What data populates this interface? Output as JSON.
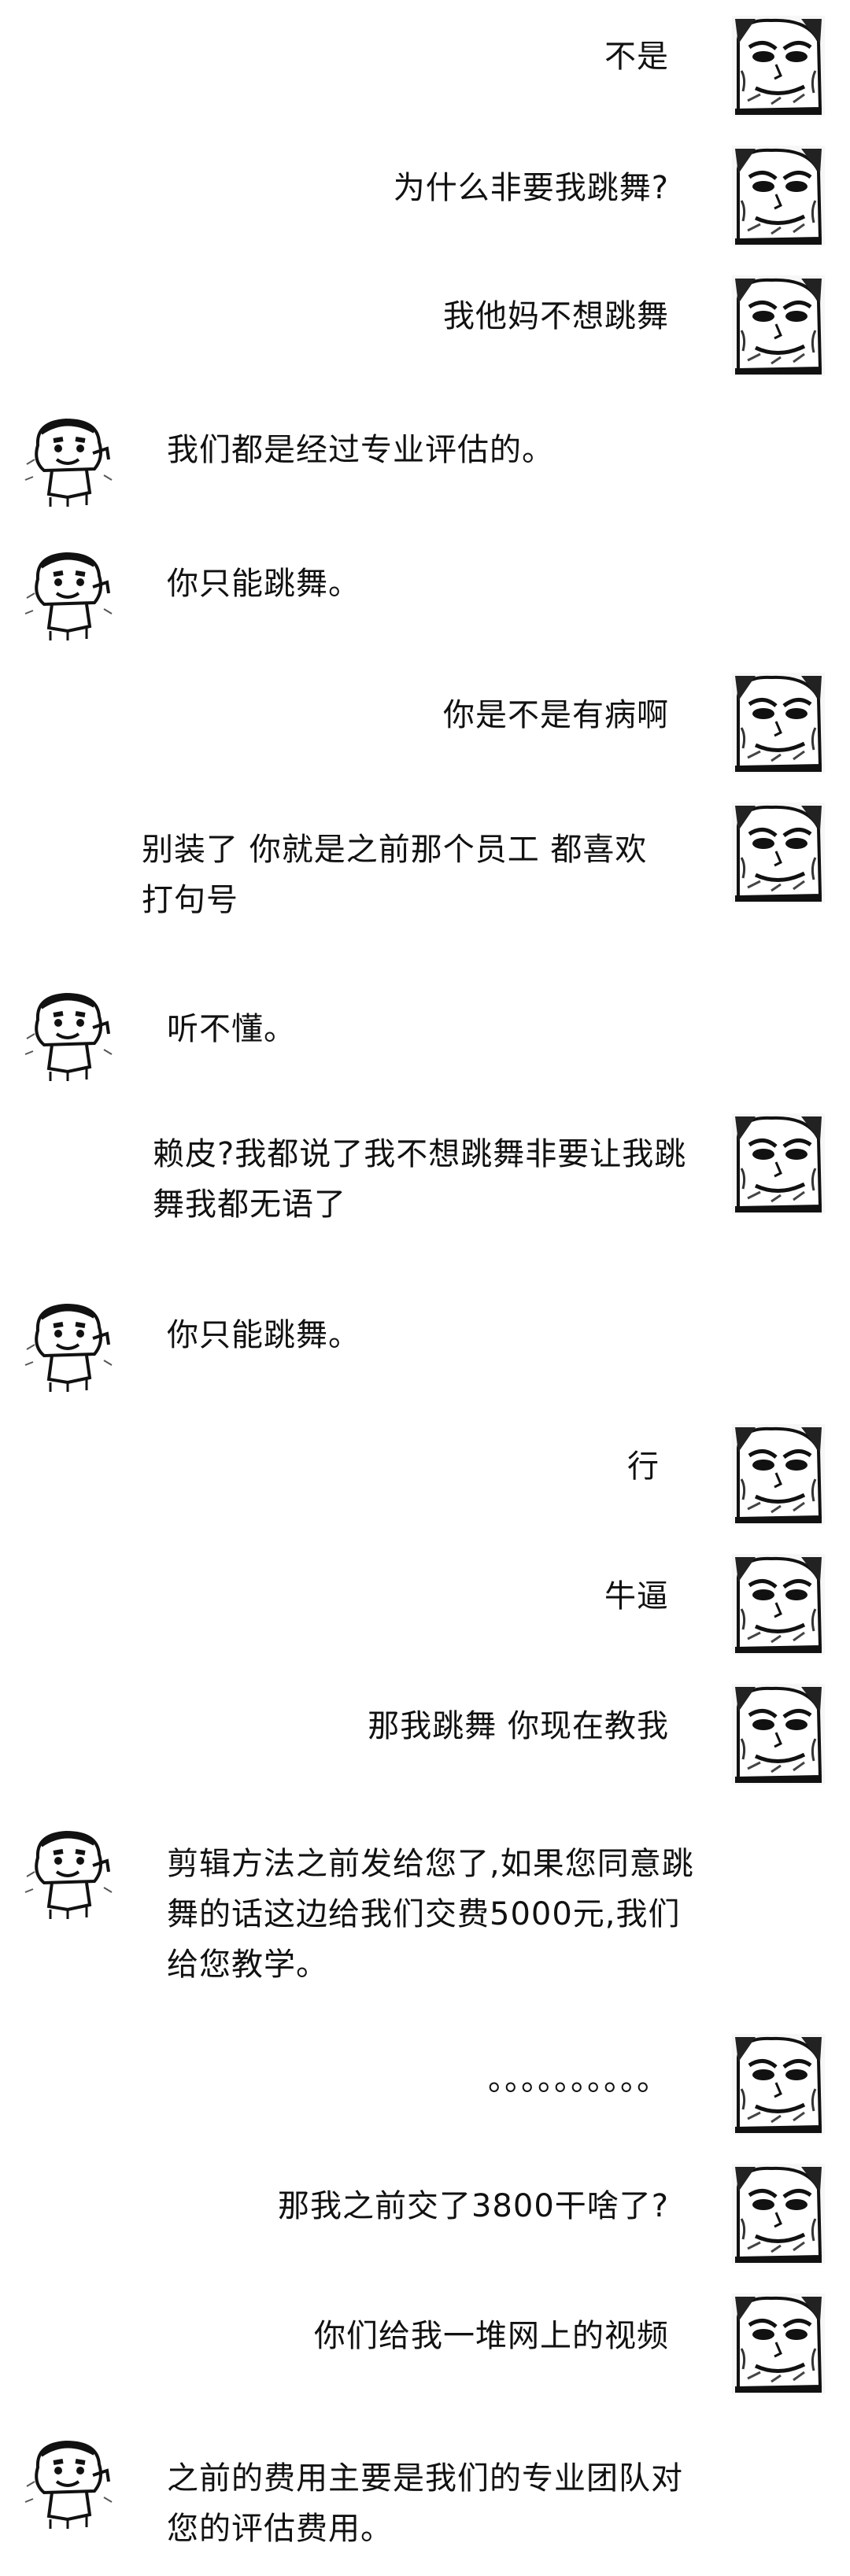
{
  "messages": [
    {
      "side": "right",
      "text": "不是",
      "avatar": "panda-meme-face-icon"
    },
    {
      "side": "right",
      "text": "为什么非要我跳舞?",
      "avatar": "panda-meme-face-icon"
    },
    {
      "side": "right",
      "text": "我他妈不想跳舞",
      "avatar": "panda-meme-face-icon"
    },
    {
      "side": "left",
      "text": "我们都是经过专业评估的。",
      "avatar": "crayon-shinchan-sketch-icon"
    },
    {
      "side": "left",
      "text": "你只能跳舞。",
      "avatar": "crayon-shinchan-sketch-icon"
    },
    {
      "side": "right",
      "text": "你是不是有病啊",
      "avatar": "panda-meme-face-icon"
    },
    {
      "side": "right",
      "text": "别装了 你就是之前那个员工 都喜欢打句号",
      "avatar": "panda-meme-face-icon"
    },
    {
      "side": "left",
      "text": "听不懂。",
      "avatar": "crayon-shinchan-sketch-icon"
    },
    {
      "side": "right",
      "text": "赖皮?我都说了我不想跳舞非要让我跳舞我都无语了",
      "avatar": "panda-meme-face-icon"
    },
    {
      "side": "left",
      "text": "你只能跳舞。",
      "avatar": "crayon-shinchan-sketch-icon"
    },
    {
      "side": "right",
      "text": "行",
      "avatar": "panda-meme-face-icon"
    },
    {
      "side": "right",
      "text": "牛逼",
      "avatar": "panda-meme-face-icon"
    },
    {
      "side": "right",
      "text": "那我跳舞 你现在教我",
      "avatar": "panda-meme-face-icon"
    },
    {
      "side": "left",
      "text": "剪辑方法之前发给您了,如果您同意跳舞的话这边给我们交费5000元,我们给您教学。",
      "avatar": "crayon-shinchan-sketch-icon"
    },
    {
      "side": "right",
      "text": "。。。。。。。。。。",
      "avatar": "panda-meme-face-icon"
    },
    {
      "side": "right",
      "text": "那我之前交了3800干啥了?",
      "avatar": "panda-meme-face-icon"
    },
    {
      "side": "right",
      "text": "你们给我一堆网上的视频",
      "avatar": "panda-meme-face-icon"
    },
    {
      "side": "left",
      "text": "之前的费用主要是我们的专业团队对您的评估费用。",
      "avatar": "crayon-shinchan-sketch-icon"
    }
  ]
}
